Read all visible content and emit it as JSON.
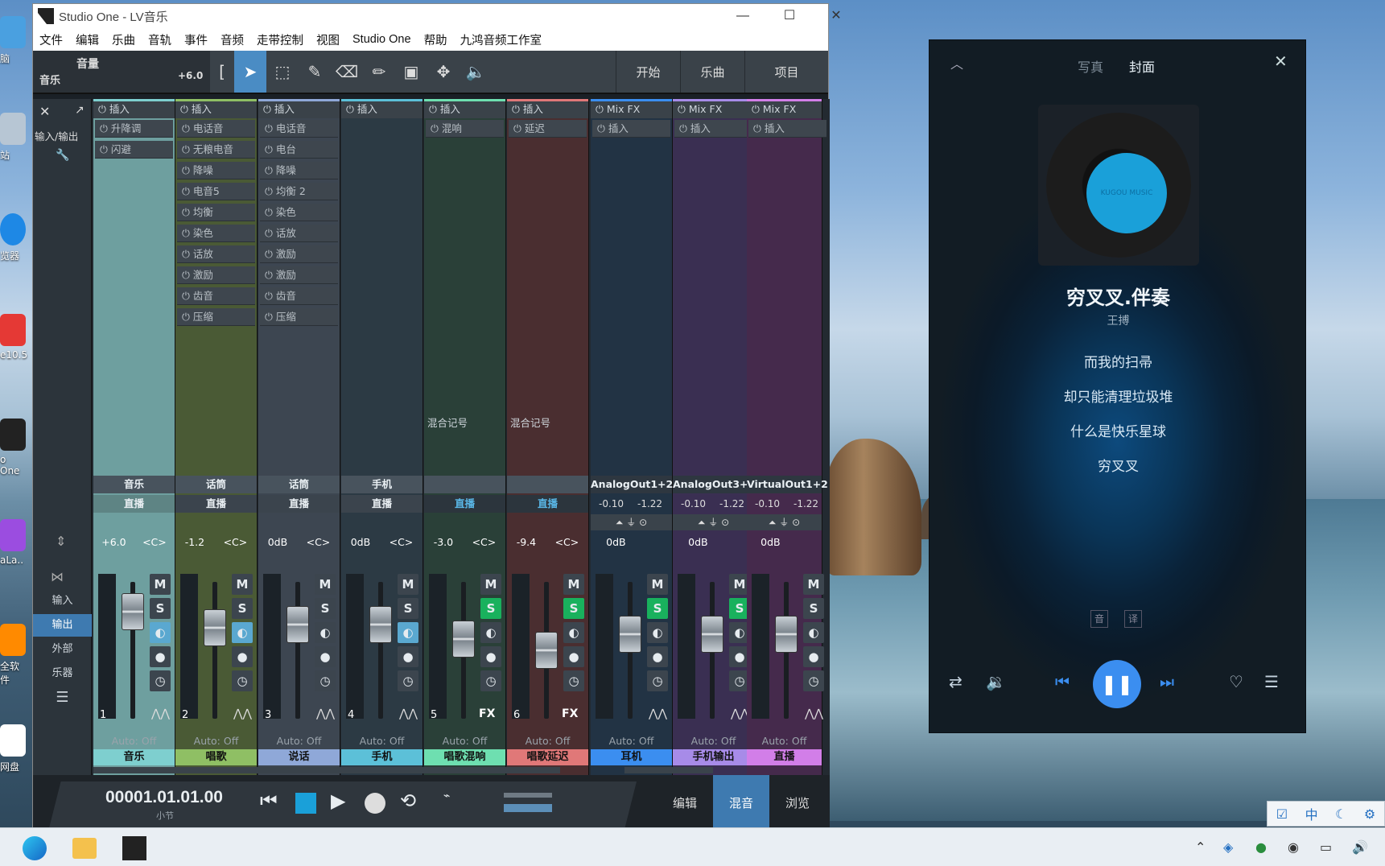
{
  "window": {
    "title": "Studio One - LV音乐",
    "minimize": "—",
    "maximize": "☐",
    "close": "✕"
  },
  "menu": [
    "文件",
    "编辑",
    "乐曲",
    "音轨",
    "事件",
    "音频",
    "走带控制",
    "视图",
    "Studio One",
    "帮助",
    "九鸿音频工作室"
  ],
  "toolbar": {
    "track_name": "音量",
    "track_sub": "音乐",
    "volume": "+6.0",
    "pages": [
      "开始",
      "乐曲",
      "项目"
    ]
  },
  "mixer": {
    "side": {
      "io": "输入/输出",
      "input": "输入",
      "output": "输出",
      "external": "外部",
      "instrument": "乐器"
    },
    "insert_label": "插入",
    "mixfx_label": "Mix FX",
    "mix_note": "混合记号",
    "auto_off": "Auto: Off",
    "channels": [
      {
        "name": "音乐",
        "input": "直播",
        "vol": "+6.0",
        "pan": "<C>",
        "num": "1",
        "label": "音乐",
        "color": "#7ecfcf",
        "bg": "#6e9f9f",
        "slots": [
          "升降调",
          "闪避"
        ],
        "fader": 0.12,
        "m": "M",
        "s": "S"
      },
      {
        "name": "话筒",
        "input": "直播",
        "vol": "-1.2",
        "pan": "<C>",
        "num": "2",
        "label": "唱歌",
        "color": "#8fbf64",
        "bg": "#4a5a35",
        "slots": [
          "电话音",
          "无粮电音",
          "降噪",
          "电音5",
          "均衡",
          "染色",
          "话放",
          "激励",
          "齿音",
          "压缩"
        ],
        "fader": 0.28,
        "m": "M",
        "s": "S"
      },
      {
        "name": "话筒",
        "input": "直播",
        "vol": "0dB",
        "pan": "<C>",
        "num": "3",
        "label": "说话",
        "color": "#8fa8d8",
        "bg": "#3d4651",
        "slots": [
          "电话音",
          "电台",
          "降噪",
          "均衡 2",
          "染色",
          "话放",
          "激励",
          "激励",
          "齿音",
          "压缩"
        ],
        "fader": 0.25,
        "m": "M",
        "s": "S"
      },
      {
        "name": "手机",
        "input": "直播",
        "vol": "0dB",
        "pan": "<C>",
        "num": "4",
        "label": "手机",
        "color": "#5cc0d8",
        "bg": "#2c3a44",
        "slots": [],
        "fader": 0.25,
        "m": "M",
        "s": "S"
      },
      {
        "name": "",
        "input": "直播",
        "vol": "-3.0",
        "pan": "<C>",
        "num": "5",
        "label": "唱歌混响",
        "color": "#6edfb0",
        "bg": "#2a4038",
        "slots": [
          "混响"
        ],
        "fader": 0.4,
        "m": "M",
        "s": "S",
        "fx": "FX",
        "note": true
      },
      {
        "name": "",
        "input": "直播",
        "vol": "-9.4",
        "pan": "<C>",
        "num": "6",
        "label": "唱歌延迟",
        "color": "#e07878",
        "bg": "#4a2e30",
        "slots": [
          "延迟"
        ],
        "fader": 0.52,
        "m": "M",
        "s": "S",
        "fx": "FX",
        "note": true
      },
      {
        "name": "AnalogOut1+2",
        "input": "",
        "vol": "0dB",
        "pan": "",
        "num": "",
        "label": "耳机",
        "color": "#3b8ef0",
        "bg": "#223344",
        "slots": [],
        "fader": 0.35,
        "m": "M",
        "s": "S",
        "mixfx": true,
        "lvl": [
          "-0.10",
          "-1.22"
        ]
      },
      {
        "name": "AnalogOut3+4",
        "input": "",
        "vol": "0dB",
        "pan": "",
        "num": "",
        "label": "手机输出",
        "color": "#a78be8",
        "bg": "#3a2f52",
        "slots": [],
        "fader": 0.35,
        "m": "M",
        "s": "S",
        "mixfx": true,
        "lvl": [
          "-0.10",
          "-1.22"
        ]
      },
      {
        "name": "VirtualOut1+2",
        "input": "",
        "vol": "0dB",
        "pan": "",
        "num": "",
        "label": "直播",
        "color": "#d27ee8",
        "bg": "#452a4c",
        "slots": [],
        "fader": 0.35,
        "m": "M",
        "s": "S",
        "mixfx": true,
        "lvl": [
          "-0.10",
          "-1.22"
        ]
      }
    ]
  },
  "transport": {
    "time": "00001.01.01.00",
    "unit": "小节",
    "pages": [
      "编辑",
      "混音",
      "浏览"
    ]
  },
  "player": {
    "tabs": [
      "写真",
      "封面"
    ],
    "song": "穷叉叉.伴奏",
    "artist": "王搏",
    "lyrics": [
      "而我的扫帚",
      "却只能清理垃圾堆",
      "什么是快乐星球",
      "穷叉叉"
    ],
    "badges": [
      "音",
      "译"
    ],
    "disc_label": "KUGOU MUSIC"
  },
  "desktop": {
    "icons": [
      "脑",
      "站",
      "览器",
      "e10.5",
      "o One",
      "aLa..",
      "全软件",
      "网盘"
    ]
  },
  "ime": [
    "中",
    "☾"
  ]
}
